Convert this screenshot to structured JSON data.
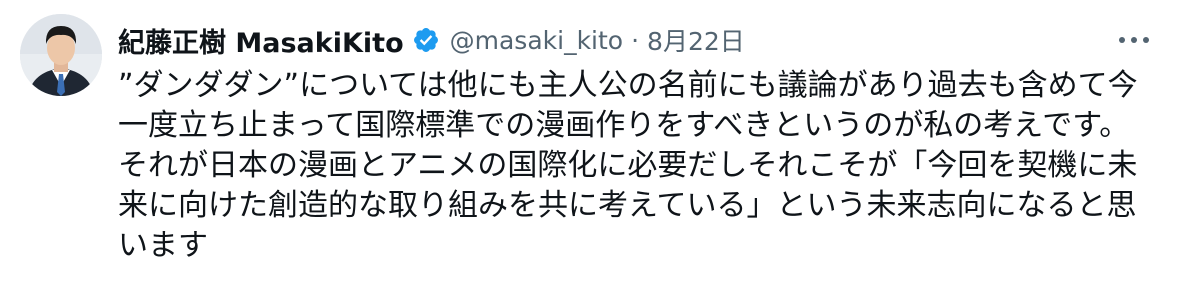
{
  "author": {
    "display_name": "紀藤正樹 MasakiKito",
    "handle": "@masaki_kito",
    "separator": "·",
    "date": "8月22日",
    "verified": true
  },
  "icons": {
    "verified": "verified-badge-icon",
    "more": "more-options-icon"
  },
  "colors": {
    "verified_blue": "#1d9bf0",
    "text": "#0f1419",
    "secondary": "#536471"
  },
  "tweet": {
    "lines": [
      "”ダンダダン”については他にも主人公の名前にも議論があり過去も含めて今",
      "一度立ち止まって国際標準での漫画作りをすべきというのが私の考えです。",
      "それが日本の漫画とアニメの国際化に必要だしそれこそが「今回を契機に未",
      "来に向けた創造的な取り組みを共に考えている」という未来志向になると思",
      "います"
    ]
  }
}
